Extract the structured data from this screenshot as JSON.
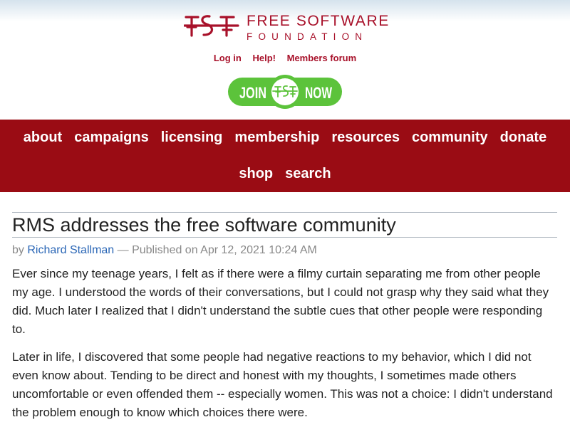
{
  "header": {
    "logo": {
      "line1": "FREE SOFTWARE",
      "line2": "FOUNDATION",
      "mark_icon": "fsf-logo-icon"
    },
    "top_links": [
      {
        "label": "Log in"
      },
      {
        "label": "Help!"
      },
      {
        "label": "Members forum"
      }
    ],
    "join_button": {
      "left": "JOIN",
      "right": "NOW",
      "icon": "fsf-logo-icon"
    }
  },
  "nav": {
    "row1": [
      {
        "label": "about"
      },
      {
        "label": "campaigns"
      },
      {
        "label": "licensing"
      },
      {
        "label": "membership"
      },
      {
        "label": "resources"
      },
      {
        "label": "community"
      },
      {
        "label": "donate"
      }
    ],
    "row2": [
      {
        "label": "shop"
      },
      {
        "label": "search"
      }
    ]
  },
  "article": {
    "title": "RMS addresses the free software community",
    "byline_prefix": "by",
    "author": "Richard Stallman",
    "published_text": "— Published on Apr 12, 2021 10:24 AM",
    "paragraphs": [
      "Ever since my teenage years, I felt as if there were a filmy curtain separating me from other people my age. I understood the words of their conversations, but I could not grasp why they said what they did. Much later I realized that I didn't understand the subtle cues that other people were responding to.",
      "Later in life, I discovered that some people had negative reactions to my behavior, which I did not even know about. Tending to be direct and honest with my thoughts, I sometimes made others uncomfortable or even offended them -- especially women. This was not a choice: I didn't understand the problem enough to know which choices there were."
    ]
  },
  "colors": {
    "brand_red": "#a8112a",
    "nav_bg": "#9a0c14",
    "join_green": "#5cc33b",
    "link_blue": "#2a66b6"
  }
}
